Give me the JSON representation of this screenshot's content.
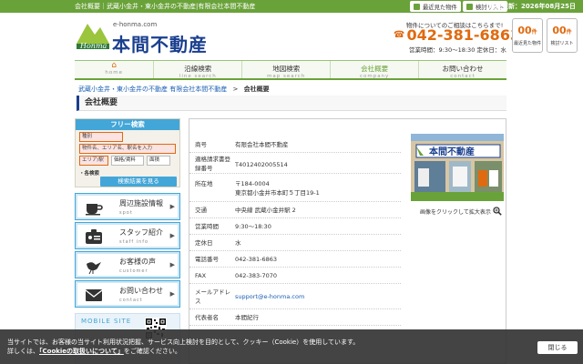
{
  "topbar": {
    "site_title": "会社概要｜武蔵小金井・東小金井の不動産|有限会社本間不動産",
    "recent_label": "最近見た物件",
    "consider_label": "検討リスト",
    "last_update_label": "最終更新：",
    "last_update_date": "2026年08月25日"
  },
  "header": {
    "logo_text": "Honma",
    "domain": "e-honma.com",
    "company": "本間不動産",
    "inquiry_text": "物件についてのご相談はこちらまで!",
    "phone": "042-381-6863",
    "hours": "営業時間：9:30〜18:30 定休日：水",
    "recent_count": "00",
    "recent_unit": "件",
    "recent_label": "最近見た物件",
    "consider_count": "00",
    "consider_unit": "件",
    "consider_label": "検討リスト"
  },
  "nav": [
    {
      "ja": "",
      "en": "home"
    },
    {
      "ja": "沿線検索",
      "en": "line search"
    },
    {
      "ja": "地図検索",
      "en": "map search"
    },
    {
      "ja": "会社概要",
      "en": "company"
    },
    {
      "ja": "お問い合わせ",
      "en": "contact"
    }
  ],
  "breadcrumb": {
    "home": "武蔵小金井・東小金井の不動産 有限会社本間不動産",
    "sep": ">",
    "current": "会社概要"
  },
  "page_title": "会社概要",
  "sidebar": {
    "free_search_title": "フリー検索",
    "type_field": "種別",
    "keyword_placeholder": "物件名、エリア名、駅名を入力",
    "area_field": "エリア/駅",
    "price_field": "価格/賃料",
    "layout_field": "面積",
    "condition_label": "・各検索",
    "submit_label": "検索結果を見る",
    "links": [
      {
        "ja": "周辺施設情報",
        "en": "spot"
      },
      {
        "ja": "スタッフ紹介",
        "en": "staff info"
      },
      {
        "ja": "お客様の声",
        "en": "customer"
      },
      {
        "ja": "お問い合わせ",
        "en": "contact"
      }
    ],
    "mobile_title": "MOBILE SITE"
  },
  "company_info": [
    {
      "label": "商号",
      "value": "有限会社本間不動産"
    },
    {
      "label": "適格請求書登録番号",
      "value": "T4012402005514"
    },
    {
      "label": "所在地",
      "value": "〒184-0004",
      "value2": "東京都小金井市本町５丁目19-1"
    },
    {
      "label": "交通",
      "value": "中央線 武蔵小金井駅 2"
    },
    {
      "label": "営業時間",
      "value": "9:30〜18:30"
    },
    {
      "label": "定休日",
      "value": "水"
    },
    {
      "label": "電話番号",
      "value": "042-381-6863"
    },
    {
      "label": "FAX",
      "value": "042-383-7070"
    },
    {
      "label": "メールアドレス",
      "value": "support@e-honma.com"
    },
    {
      "label": "代表者名",
      "value": "本間紀行"
    }
  ],
  "photo_caption": "画像をクリックして拡大表示",
  "photo_sign": "本間不動産",
  "cookie": {
    "line1": "当サイトでは、お客様の当サイト利用状況把握、サービス向上検討を目的として、クッキー（Cookie）を使用しています。",
    "line2_prefix": "詳しくは、",
    "line2_link": "「Cookieの取扱いについて」",
    "line2_suffix": "をご確認ください。",
    "close_label": "閉じる"
  },
  "colors": {
    "green": "#6aa23a",
    "navy": "#1a3f8f",
    "orange": "#e06a10",
    "blue": "#43a6d8"
  }
}
